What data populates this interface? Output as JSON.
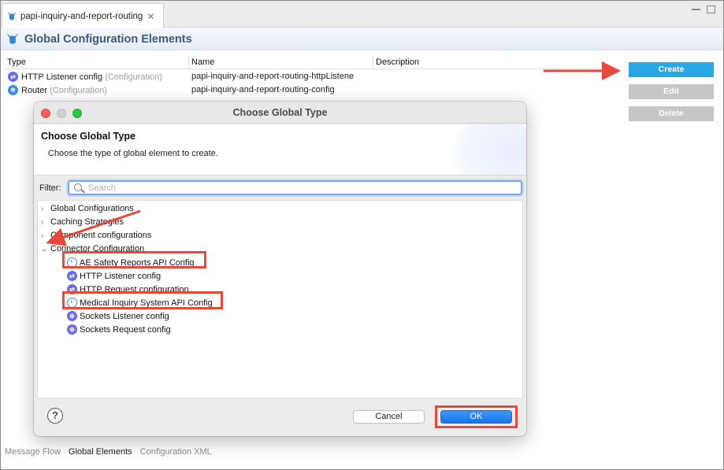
{
  "editor_tab": {
    "title": "papi-inquiry-and-report-routing",
    "close_glyph": "✕",
    "icon": "mule-icon"
  },
  "page": {
    "title": "Global Configuration Elements",
    "icon": "mule-icon"
  },
  "table": {
    "columns": [
      "Type",
      "Name",
      "Description"
    ],
    "rows": [
      {
        "type": "HTTP Listener config",
        "type_suffix": "(Configuration)",
        "name": "papi-inquiry-and-report-routing-httpListene",
        "description": "",
        "icon": "http-icon"
      },
      {
        "type": "Router",
        "type_suffix": "(Configuration)",
        "name": "papi-inquiry-and-report-routing-config",
        "description": "",
        "icon": "router-icon"
      }
    ]
  },
  "actions": {
    "create": "Create",
    "edit": "Edit",
    "delete": "Delete"
  },
  "bottom_tabs": [
    "Message Flow",
    "Global Elements",
    "Configuration XML"
  ],
  "bottom_tabs_active": "Global Elements",
  "dialog": {
    "title": "Choose Global Type",
    "heading": "Choose Global Type",
    "description": "Choose the type of global element to create.",
    "filter_label": "Filter:",
    "filter_placeholder": "Search",
    "filter_value": "",
    "tree": {
      "categories": [
        {
          "label": "Global Configurations",
          "expanded": false
        },
        {
          "label": "Caching Strategies",
          "expanded": false
        },
        {
          "label": "Component configurations",
          "expanded": false
        },
        {
          "label": "Connector Configuration",
          "expanded": true
        }
      ],
      "children": [
        {
          "label": "AE Safety Reports API Config",
          "icon": "connector-icon",
          "highlighted": true
        },
        {
          "label": "HTTP Listener config",
          "icon": "http-icon",
          "highlighted": false
        },
        {
          "label": "HTTP Request configuration",
          "icon": "http-icon",
          "highlighted": false
        },
        {
          "label": "Medical Inquiry System API Config",
          "icon": "connector-icon",
          "highlighted": true
        },
        {
          "label": "Sockets Listener config",
          "icon": "sockets-icon",
          "highlighted": false
        },
        {
          "label": "Sockets Request config",
          "icon": "sockets-icon",
          "highlighted": false
        }
      ]
    },
    "help_glyph": "?",
    "cancel": "Cancel",
    "ok": "OK"
  },
  "colors": {
    "accent": "#2aa8e6",
    "annotation": "#e8483a",
    "ok_button": "#1775ea",
    "header_text": "#3c5a7e"
  }
}
